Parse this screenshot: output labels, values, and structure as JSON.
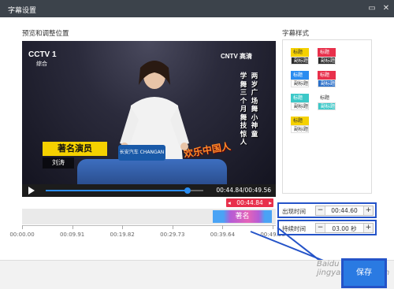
{
  "window": {
    "title": "字幕设置"
  },
  "preview": {
    "section_title": "预览和调整位置"
  },
  "video": {
    "channel_logo": "CCTV 1",
    "channel_sub": "综合",
    "hd_logo": "CNTV 高清",
    "vertical_caption_1": "两岁广场舞小神童",
    "vertical_caption_2": "学舞三个月舞技惊人",
    "name_plate": "著名演员",
    "name_sub": "刘涛",
    "sponsor": "长安汽车 CHANGAN",
    "show_title": "欢乐中国人",
    "played_fraction": 0.9
  },
  "player": {
    "time_readout": "00:44.84/00:49.56"
  },
  "timeline": {
    "marker_time": "00:44.84",
    "clip_label": "著名",
    "ticks": [
      "00:00.00",
      "00:09.91",
      "00:19.82",
      "00:29.73",
      "00:39.64",
      "00:49.56"
    ]
  },
  "styles": {
    "section_title": "字幕样式",
    "options": [
      {
        "top": "标题",
        "bottom": "副标题",
        "top_bg": "#f5d100",
        "top_color": "#333",
        "bot_bg": "#2b2b2b",
        "bot_color": "#fff"
      },
      {
        "top": "标题",
        "bottom": "副标题",
        "top_bg": "#e8304b",
        "top_color": "#fff",
        "bot_bg": "#2b2b2b",
        "bot_color": "#fff"
      },
      {
        "top": "标题",
        "bottom": "副标题",
        "top_bg": "#2a8cf0",
        "top_color": "#fff",
        "bot_bg": "#ffffff",
        "bot_color": "#333"
      },
      {
        "top": "标题",
        "bottom": "副标题",
        "top_bg": "#e8304b",
        "top_color": "#fff",
        "bot_bg": "#2a6fc9",
        "bot_color": "#fff"
      },
      {
        "top": "标题",
        "bottom": "副标题",
        "top_bg": "#3cc8c8",
        "top_color": "#fff",
        "bot_bg": "#ffffff",
        "bot_color": "#333"
      },
      {
        "top": "标题",
        "bottom": "副标题",
        "top_bg": "#ffffff",
        "top_color": "#333",
        "bot_bg": "#3cc8c8",
        "bot_color": "#fff"
      },
      {
        "top": "标题",
        "bottom": "副标题",
        "top_bg": "#f5d100",
        "top_color": "#333",
        "bot_bg": "#ffffff",
        "bot_color": "#333"
      }
    ]
  },
  "settings": {
    "appear_label": "出现时间",
    "appear_value": "00:44.60",
    "duration_label": "持续时间",
    "duration_value": "03.00 秒",
    "minus": "−",
    "plus": "+"
  },
  "footer": {
    "save_label": "保存",
    "watermark": "Baidu jingyan.baidu.com"
  },
  "colors": {
    "titlebar": "#3c434b",
    "accent": "#2a8cf0",
    "highlight_box": "#2453c8",
    "marker": "#e8304b"
  }
}
